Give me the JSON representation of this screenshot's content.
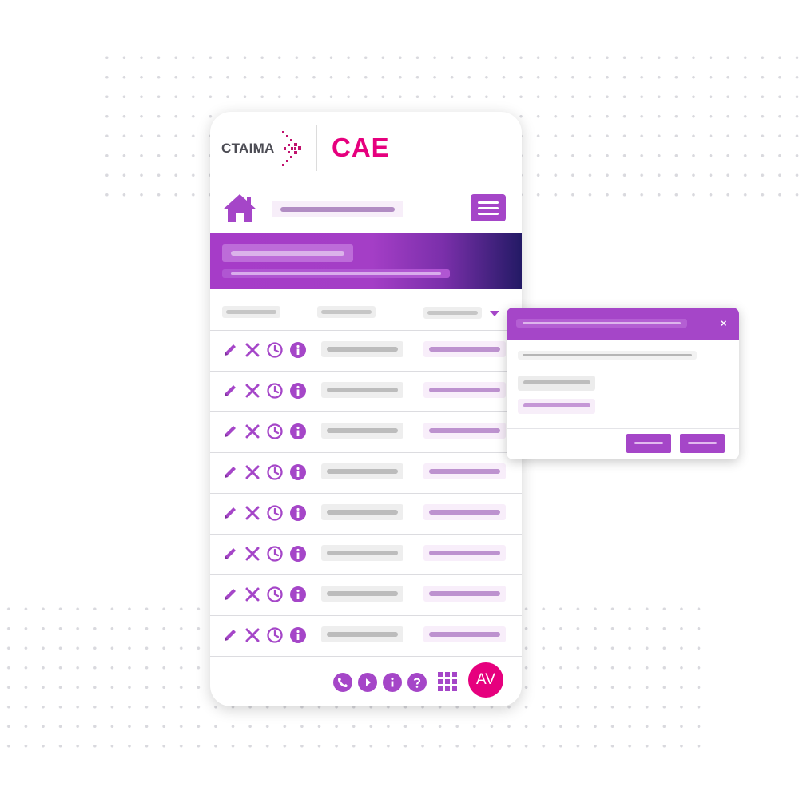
{
  "brand": {
    "company_name": "CTAIMA",
    "product_name": "CAE",
    "company_color": "#4c4c54",
    "product_color": "#e6007e"
  },
  "colors": {
    "accent": "#a546c8",
    "banner_gradient_end": "#231a65",
    "avatar_bg": "#e6007e"
  },
  "topnav": {
    "home_icon": "home-icon",
    "menu_icon": "hamburger-menu-icon"
  },
  "table": {
    "row_action_icons": [
      "pencil-icon",
      "close-icon",
      "clock-icon",
      "info-icon"
    ],
    "row_count": 8,
    "sort_icon": "caret-down-icon"
  },
  "footer": {
    "icons": [
      "phone-icon",
      "play-icon",
      "info-icon",
      "help-icon",
      "apps-grid-icon"
    ],
    "avatar_initials": "AV"
  },
  "dialog": {
    "close_glyph": "×"
  }
}
